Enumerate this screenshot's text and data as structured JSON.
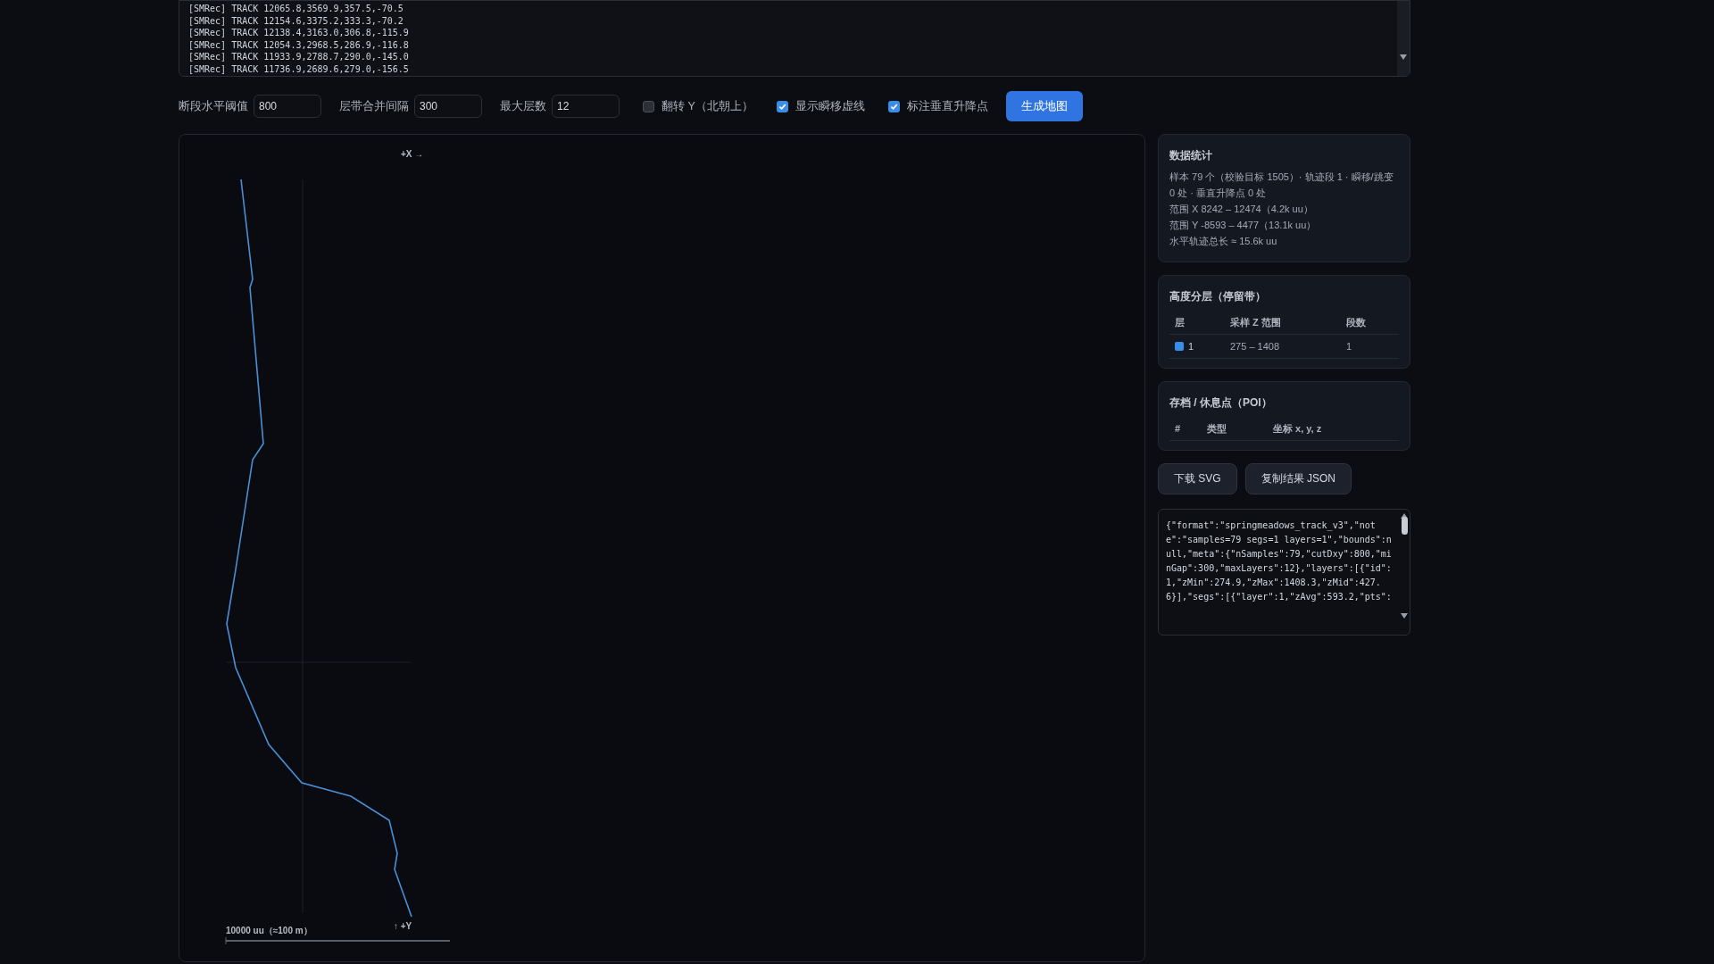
{
  "log_lines": [
    "[SMRec] TRACK 12065.8,3569.9,357.5,-70.5",
    "[SMRec] TRACK 12154.6,3375.2,333.3,-70.2",
    "[SMRec] TRACK 12138.4,3163.0,306.8,-115.9",
    "[SMRec] TRACK 12054.3,2968.5,286.9,-116.8",
    "[SMRec] TRACK 11933.9,2788.7,290.0,-145.0",
    "[SMRec] TRACK 11736.9,2689.6,279.0,-156.5"
  ],
  "controls": {
    "fields": [
      {
        "label": "断段水平阈值",
        "value": "800"
      },
      {
        "label": "层带合并间隔",
        "value": "300"
      },
      {
        "label": "最大层数",
        "value": "12"
      }
    ],
    "checkboxes": [
      {
        "label": "翻转 Y（北朝上）",
        "checked": false
      },
      {
        "label": "显示瞬移虚线",
        "checked": true
      },
      {
        "label": "标注垂直升降点",
        "checked": true
      }
    ],
    "generate_button": "生成地图"
  },
  "map": {
    "x_axis_label": "+X →",
    "y_axis_label": "↑ +Y",
    "scale_label": "10000 uu（≈100 m）"
  },
  "stats": {
    "title": "数据统计",
    "lines": [
      "样本 79 个（校验目标 1505）· 轨迹段 1 · 瞬移/跳变 0 处 · 垂直升降点 0 处",
      "范围 X 8242 – 12474（4.2k uu）",
      "范围 Y -8593 – 4477（13.1k uu）",
      "水平轨迹总长 ≈ 15.6k uu"
    ]
  },
  "layers": {
    "title": "高度分层（停留带）",
    "columns": [
      "层",
      "采样 Z 范围",
      "段数"
    ],
    "rows": [
      {
        "layer": "1",
        "color": "#3b8ee8",
        "z_range": "275 – 1408",
        "segments": "1"
      }
    ]
  },
  "poi": {
    "title": "存档 / 休息点（POI）",
    "columns": [
      "#",
      "类型",
      "坐标 x, y, z"
    ]
  },
  "buttons": [
    "下载 SVG",
    "复制结果 JSON"
  ],
  "json_output": "{\"format\":\"springmeadows_track_v3\",\"note\":\"samples=79 segs=1 layers=1\",\"bounds\":null,\"meta\":{\"nSamples\":79,\"cutDxy\":800,\"minGap\":300,\"maxLayers\":12},\"layers\":[{\"id\":1,\"zMin\":274.9,\"zMax\":1408.3,\"zMid\":427.6}],\"segs\":[{\"layer\":1,\"zAvg\":593.2,\"pts\":"
}
